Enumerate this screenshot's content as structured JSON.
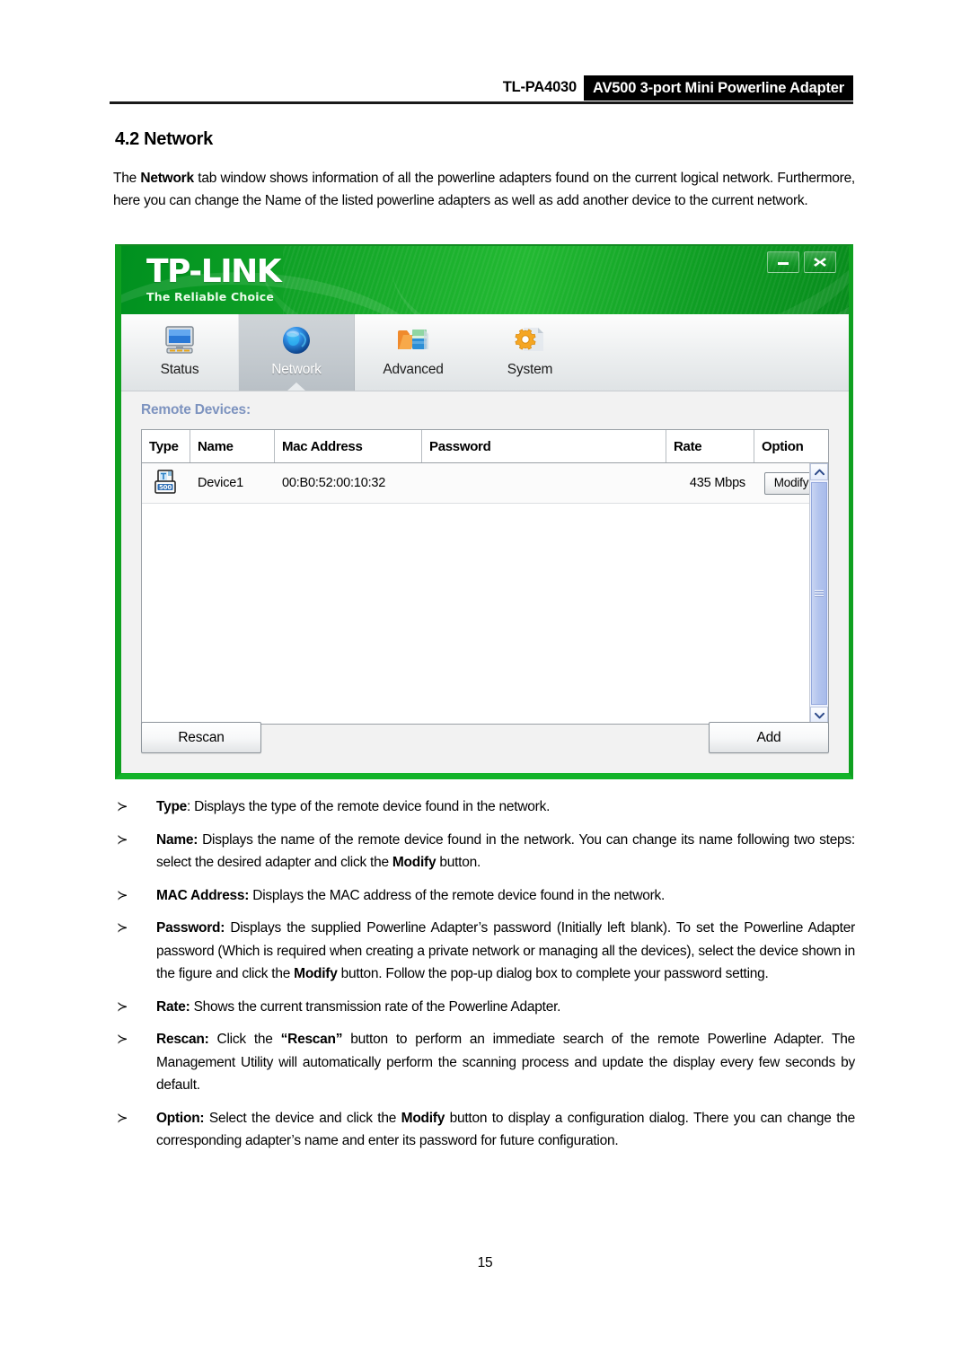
{
  "doc_header": {
    "model": "TL-PA4030",
    "product": "AV500 3-port Mini Powerline Adapter"
  },
  "section": {
    "title": "4.2 Network",
    "intro_part1": "The ",
    "intro_bold": "Network",
    "intro_part2": " tab window shows information of all the powerline adapters found on the current logical network. Furthermore, here you can change the Name of the listed powerline adapters as well as add another device to the current network."
  },
  "app": {
    "logo": "TP-LINK",
    "tagline": "The Reliable Choice",
    "window_controls": [
      {
        "name": "minimize",
        "glyph": "minimize-icon"
      },
      {
        "name": "close",
        "glyph": "close-icon"
      }
    ],
    "tabs": [
      {
        "label": "Status",
        "icon": "monitor-icon",
        "active": false
      },
      {
        "label": "Network",
        "icon": "globe-icon",
        "active": true
      },
      {
        "label": "Advanced",
        "icon": "database-folder-icon",
        "active": false
      },
      {
        "label": "System",
        "icon": "gear-icon",
        "active": false
      }
    ],
    "remote_devices_label": "Remote Devices:",
    "table": {
      "columns": [
        "Type",
        "Name",
        "Mac Address",
        "Password",
        "Rate",
        "Option"
      ],
      "rows": [
        {
          "type_icon": "powerline-adapter-icon",
          "type_icon_badge": "500",
          "name": "Device1",
          "mac": "00:B0:52:00:10:32",
          "password": "",
          "rate": "435 Mbps",
          "option": "Modify"
        }
      ]
    },
    "buttons": {
      "rescan": "Rescan",
      "add": "Add"
    },
    "colors": {
      "brand_green": "#13b32a",
      "banner_green_dark": "#00901f",
      "remote_label_blue": "#7d93bf",
      "scrollbar_blue": "#b3c4ee"
    }
  },
  "bullets": [
    {
      "arrow": "≻",
      "segments": [
        {
          "text": "Type",
          "bold": true
        },
        {
          "text": ": Displays the type of the remote device found in the network.",
          "bold": false
        }
      ]
    },
    {
      "arrow": "≻",
      "segments": [
        {
          "text": "Name:",
          "bold": true
        },
        {
          "text": " Displays the name of the remote device found in the network. You can change its name following two steps: select the desired adapter and click the ",
          "bold": false
        },
        {
          "text": "Modify",
          "bold": true
        },
        {
          "text": " button.",
          "bold": false
        }
      ]
    },
    {
      "arrow": "≻",
      "segments": [
        {
          "text": "MAC Address:",
          "bold": true
        },
        {
          "text": " Displays the MAC address of the remote device found in the network.",
          "bold": false
        }
      ]
    },
    {
      "arrow": "≻",
      "segments": [
        {
          "text": "Password:",
          "bold": true
        },
        {
          "text": " Displays the supplied Powerline Adapter’s password (Initially left blank). To set the Powerline Adapter password (Which is required when creating a private network or managing all the devices), select the device shown in the figure and click the ",
          "bold": false
        },
        {
          "text": "Modify",
          "bold": true
        },
        {
          "text": " button. Follow the pop-up dialog box to complete your password setting.",
          "bold": false
        }
      ]
    },
    {
      "arrow": "≻",
      "segments": [
        {
          "text": "Rate:",
          "bold": true
        },
        {
          "text": " Shows the current transmission rate of the Powerline Adapter.",
          "bold": false
        }
      ]
    },
    {
      "arrow": "≻",
      "segments": [
        {
          "text": "Rescan:",
          "bold": true
        },
        {
          "text": " Click the ",
          "bold": false
        },
        {
          "text": "“Rescan”",
          "bold": true
        },
        {
          "text": " button to perform an immediate search of the remote Powerline Adapter. The Management Utility will automatically perform the scanning process and update the display every few seconds by default.",
          "bold": false
        }
      ]
    },
    {
      "arrow": "≻",
      "segments": [
        {
          "text": "Option:",
          "bold": true
        },
        {
          "text": " Select the device and click the ",
          "bold": false
        },
        {
          "text": "Modify",
          "bold": true
        },
        {
          "text": " button to display a configuration dialog. There you can change the corresponding adapter’s name and enter its password for future configuration.",
          "bold": false
        }
      ]
    }
  ],
  "page_number": "15"
}
